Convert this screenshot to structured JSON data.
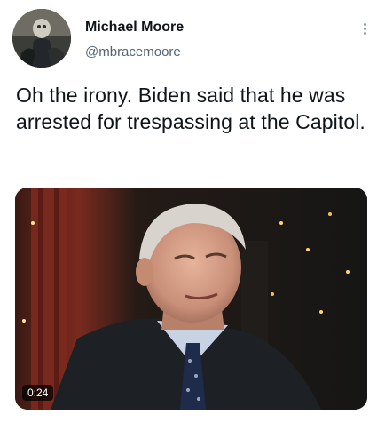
{
  "author": {
    "display_name": "Michael Moore",
    "handle": "@mbracemoore"
  },
  "tweet": {
    "text": "Oh the irony. Biden said that he was arrested for trespassing at the Capitol."
  },
  "media": {
    "type": "video",
    "duration": "0:24"
  },
  "icons": {
    "more": "more-vertical-icon",
    "avatar": "avatar"
  },
  "colors": {
    "text_primary": "#0f1419",
    "text_secondary": "#536471",
    "badge_bg": "#000000"
  }
}
